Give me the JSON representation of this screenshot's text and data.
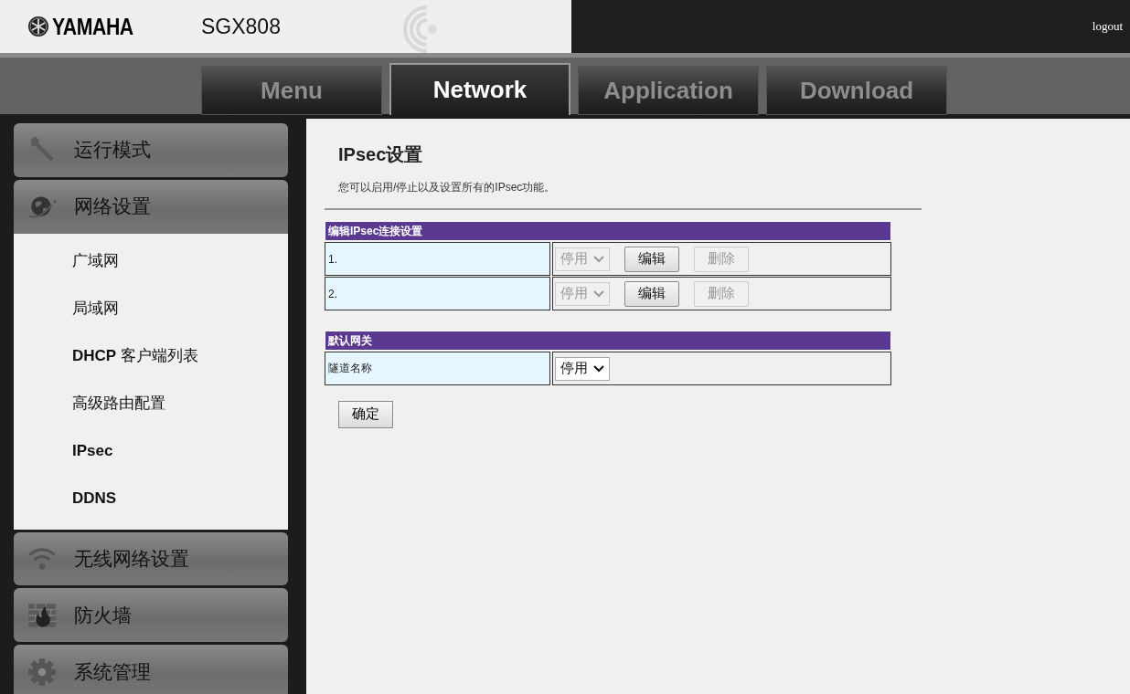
{
  "header": {
    "logo": "YAMAHA",
    "model": "SGX808",
    "logout": "logout"
  },
  "tabs": [
    {
      "label": "Menu",
      "selected": false
    },
    {
      "label": "Network",
      "selected": true
    },
    {
      "label": "Application",
      "selected": false
    },
    {
      "label": "Download",
      "selected": false
    }
  ],
  "sidebar": [
    {
      "label": "运行模式",
      "kind": "wrench",
      "expanded": false
    },
    {
      "label": "网络设置",
      "kind": "globe",
      "expanded": true,
      "children": [
        {
          "label": "广域网",
          "bold": false
        },
        {
          "label": "局域网",
          "bold": false
        },
        {
          "label": "**DHCP** 客户端列表",
          "bold": false
        },
        {
          "label": "高级路由配置",
          "bold": false
        },
        {
          "label": "IPsec",
          "bold": true
        },
        {
          "label": "DDNS",
          "bold": true
        }
      ]
    },
    {
      "label": "无线网络设置",
      "kind": "wifi",
      "expanded": false
    },
    {
      "label": "防火墙",
      "kind": "firewall",
      "expanded": false
    },
    {
      "label": "系统管理",
      "kind": "gear",
      "expanded": false
    }
  ],
  "content": {
    "title": "IPsec设置",
    "description": "您可以启用/停止以及设置所有的IPsec功能。",
    "sections": [
      {
        "heading": "编辑IPsec连接设置",
        "rows": [
          {
            "label": "1.",
            "select": {
              "value": "停用",
              "disabled": true
            },
            "buttons": [
              {
                "label": "编辑",
                "disabled": false
              },
              {
                "label": "删除",
                "disabled": true
              }
            ]
          },
          {
            "label": "2.",
            "select": {
              "value": "停用",
              "disabled": true
            },
            "buttons": [
              {
                "label": "编辑",
                "disabled": false
              },
              {
                "label": "删除",
                "disabled": true
              }
            ]
          }
        ]
      },
      {
        "heading": "默认网关",
        "rows": [
          {
            "label": "隧道名称",
            "select": {
              "value": "停用",
              "disabled": false
            }
          }
        ]
      }
    ],
    "confirm": "确定"
  }
}
